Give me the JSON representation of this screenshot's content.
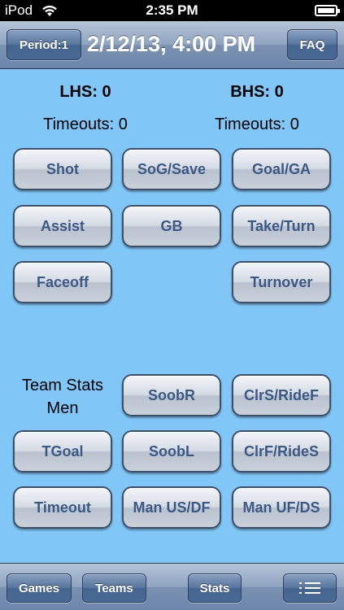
{
  "status_bar": {
    "carrier": "iPod",
    "time": "2:35 PM"
  },
  "nav": {
    "period_label": "Period:1",
    "title": "2/12/13, 4:00 PM",
    "faq_label": "FAQ"
  },
  "scoreboard": {
    "lhs_score": "LHS: 0",
    "bhs_score": "BHS: 0",
    "lhs_timeouts": "Timeouts: 0",
    "bhs_timeouts": "Timeouts: 0"
  },
  "stat_buttons": {
    "shot": "Shot",
    "sog_save": "SoG/Save",
    "goal_ga": "Goal/GA",
    "assist": "Assist",
    "gb": "GB",
    "take_turn": "Take/Turn",
    "faceoff": "Faceoff",
    "turnover": "Turnover"
  },
  "team_section": {
    "label_line1": "Team Stats",
    "label_line2": "Men",
    "soobr": "SoobR",
    "clrs_ridef": "ClrS/RideF",
    "tgoal": "TGoal",
    "soobl": "SoobL",
    "clrf_rides": "ClrF/RideS",
    "timeout": "Timeout",
    "man_us_df": "Man US/DF",
    "man_uf_ds": "Man UF/DS"
  },
  "tab_bar": {
    "games": "Games",
    "teams": "Teams",
    "stats": "Stats",
    "menu_icon": "list-icon"
  }
}
